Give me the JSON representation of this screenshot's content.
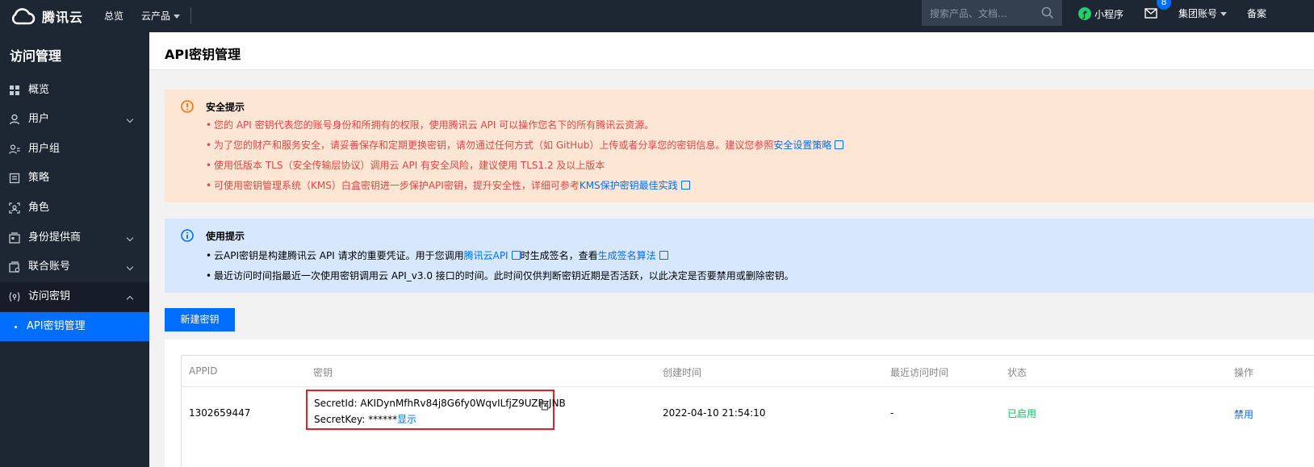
{
  "topbar": {
    "brand": "腾讯云",
    "overview": "总览",
    "products": "云产品",
    "search_placeholder": "搜索产品、文档...",
    "mini_program": "小程序",
    "mail_badge": "8",
    "account": "集团账号",
    "beian": "备案"
  },
  "sidebar": {
    "title": "访问管理",
    "items": [
      {
        "label": "概览",
        "icon": "dashboard-icon"
      },
      {
        "label": "用户",
        "icon": "user-icon"
      },
      {
        "label": "用户组",
        "icon": "user-group-icon"
      },
      {
        "label": "策略",
        "icon": "policy-icon"
      },
      {
        "label": "角色",
        "icon": "role-icon"
      },
      {
        "label": "身份提供商",
        "icon": "identity-provider-icon"
      },
      {
        "label": "联合账号",
        "icon": "federated-account-icon"
      },
      {
        "label": "访问密钥",
        "icon": "access-key-icon"
      },
      {
        "label": "API密钥管理",
        "icon": "bullet"
      }
    ]
  },
  "page": {
    "title": "API密钥管理"
  },
  "security_alert": {
    "title": "安全提示",
    "line1": "您的 API 密钥代表您的账号身份和所拥有的权限，使用腾讯云 API 可以操作您名下的所有腾讯云资源。",
    "line2": "为了您的财产和服务安全，请妥善保存和定期更换密钥，请勿通过任何方式（如 GitHub）上传或者分享您的密钥信息。建议您参照",
    "line2_link": "安全设置策略",
    "line3": "使用低版本 TLS（安全传输层协议）调用云 API 有安全风险，建议使用 TLS1.2 及以上版本",
    "line4": "可使用密钥管理系统（KMS）白盒密钥进一步保护API密钥，提升安全性，详细可参考",
    "line4_link": "KMS保护密钥最佳实践"
  },
  "usage_alert": {
    "title": "使用提示",
    "line1_a": "云API密钥是构建腾讯云 API 请求的重要凭证。用于您调用",
    "line1_link1": "腾讯云API",
    "line1_b": "时生成签名，查看",
    "line1_link2": "生成签名算法",
    "line2": "最近访问时间指最近一次使用密钥调用云 API_v3.0 接口的时间。此时间仅供判断密钥近期是否活跃，以此决定是否要禁用或删除密钥。"
  },
  "actions": {
    "new_key": "新建密钥"
  },
  "table": {
    "headers": {
      "appid": "APPID",
      "key": "密钥",
      "created": "创建时间",
      "last_access": "最近访问时间",
      "status": "状态",
      "ops": "操作"
    },
    "rows": [
      {
        "appid": "1302659447",
        "secret_id_label": "SecretId: ",
        "secret_id": "AKIDynMfhRv84j8G6fy0WqvILfjZ9UZPzJNB",
        "secret_key_label": "SecretKey: ",
        "secret_key_mask": "******",
        "show_label": "显示",
        "created": "2022-04-10 21:54:10",
        "last_access": "-",
        "status": "已启用",
        "op": "禁用"
      }
    ]
  },
  "colors": {
    "topbar": "#1d2633",
    "accent": "#006eff",
    "warn_bg": "#fde6d4",
    "warn_text": "#e54545",
    "info_bg": "#d6e7fe",
    "status_enabled": "#0abf5b",
    "highlight_box": "#e1202b"
  }
}
